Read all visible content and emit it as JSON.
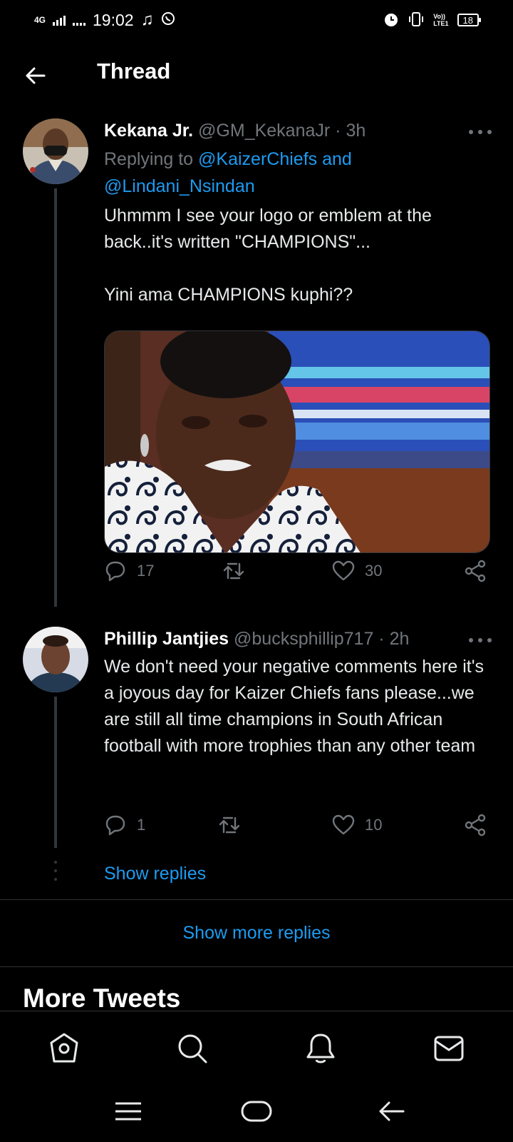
{
  "status_bar": {
    "network": "4G",
    "time": "19:02",
    "lte_label_1": "Vo))",
    "lte_label_2": "LTE1",
    "battery": "18"
  },
  "header": {
    "title": "Thread"
  },
  "tweets": [
    {
      "name": "Kekana Jr.",
      "handle": "@GM_KekanaJr",
      "time": "· 3h",
      "replying_prefix": "Replying to ",
      "replying_to": "@KaizerChiefs and @Lindani_Nsindan",
      "text": "Uhmmm I see your logo or emblem at the back..it's written \"CHAMPIONS\"...\n\nYini ama CHAMPIONS kuphi??",
      "reply_count": "17",
      "retweet_count": "",
      "like_count": "30"
    },
    {
      "name": "Phillip Jantjies",
      "handle": "@bucksphillip717",
      "time": "· 2h",
      "text": "We don't need your negative comments here it's a joyous day for Kaizer Chiefs fans please...we are still all time champions in South African football with more trophies than any other team",
      "reply_count": "1",
      "retweet_count": "",
      "like_count": "10"
    }
  ],
  "show_replies_label": "Show replies",
  "show_more_replies_label": "Show more replies",
  "more_tweets_title": "More Tweets",
  "tabs": [
    {
      "icon": "home-icon"
    },
    {
      "icon": "search-icon"
    },
    {
      "icon": "bell-icon"
    },
    {
      "icon": "mail-icon"
    }
  ],
  "colors": {
    "background": "#000000",
    "accent": "#1d9bf0",
    "secondary_text": "#71767b",
    "primary_text": "#e7e9ea"
  }
}
